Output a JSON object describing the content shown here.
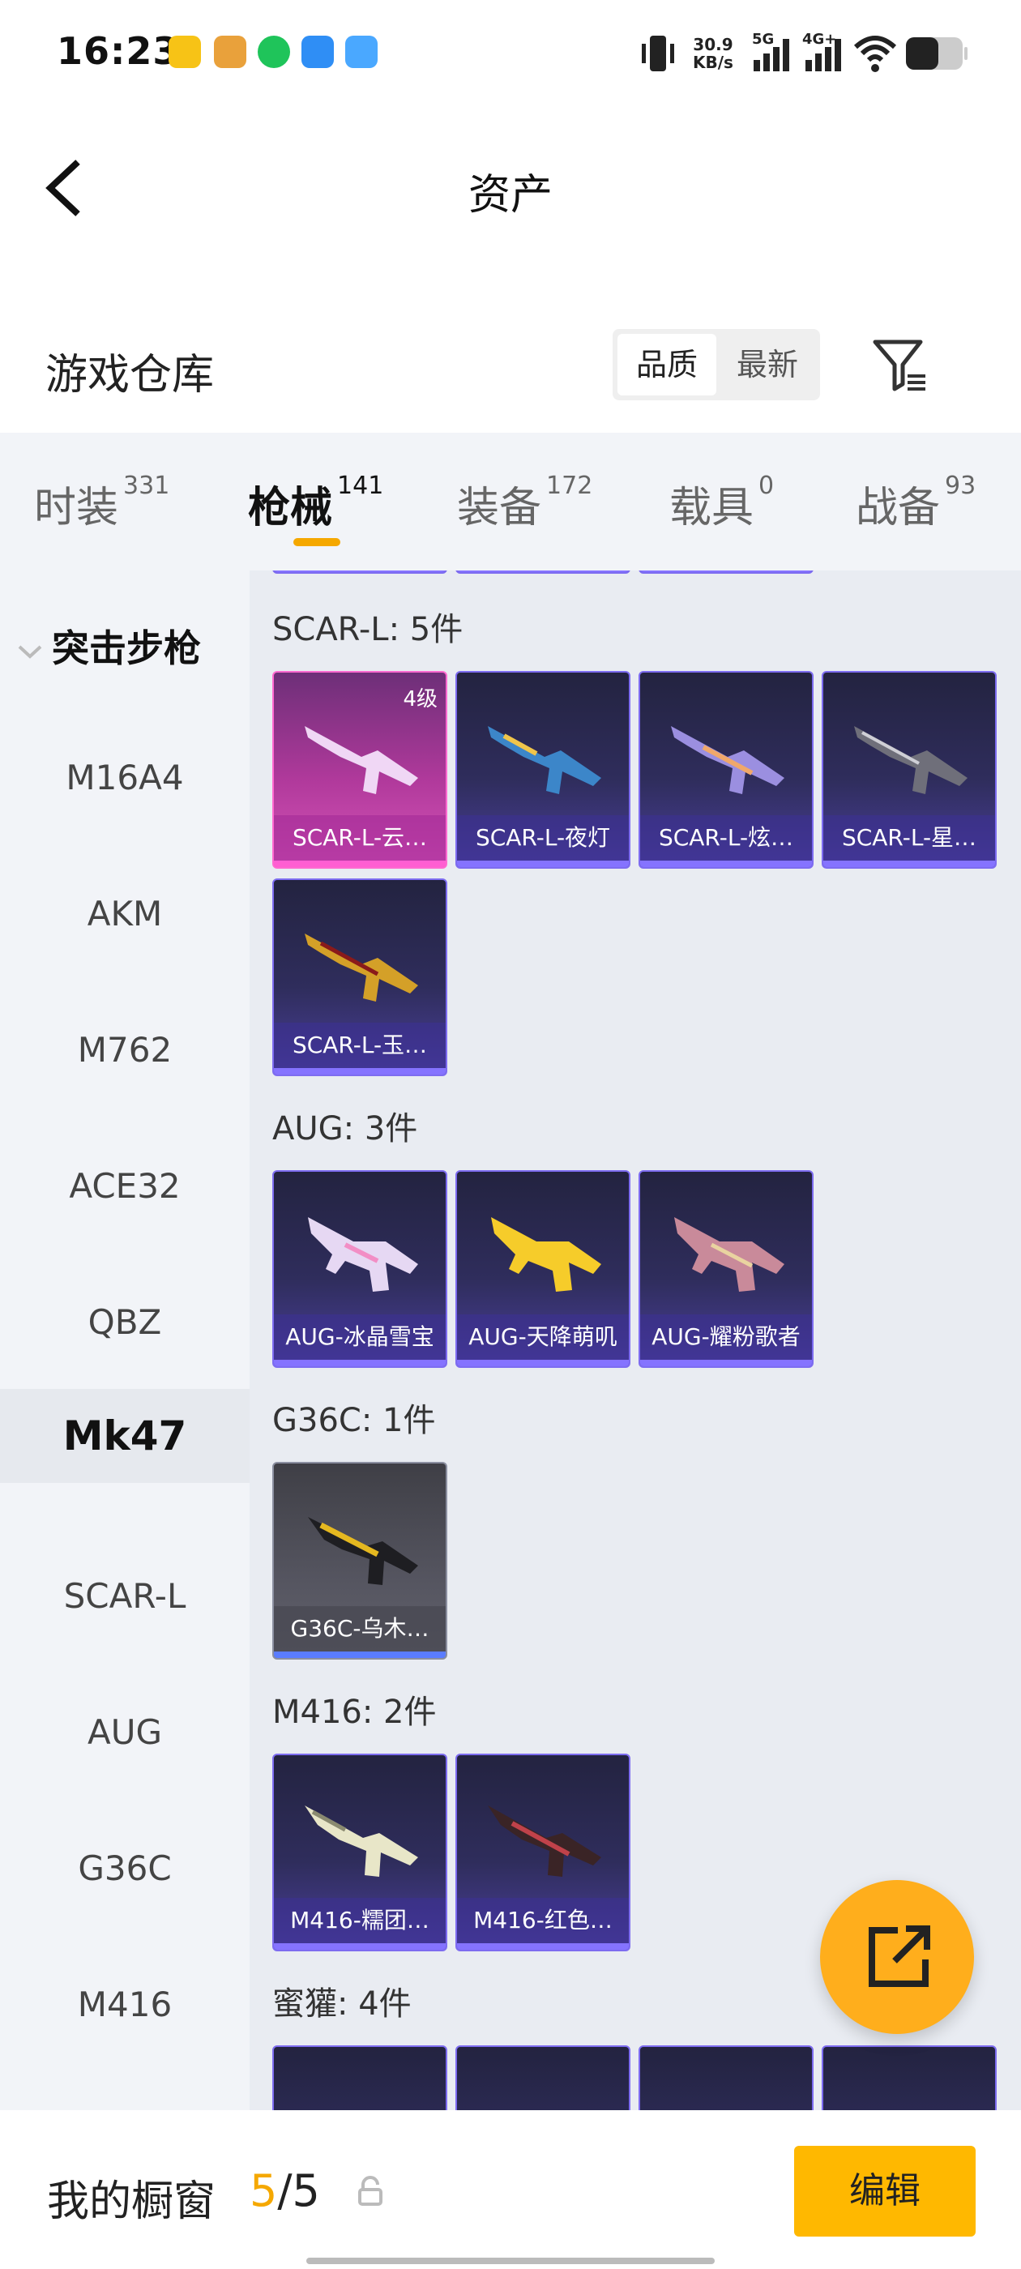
{
  "status_bar": {
    "time": "16:23",
    "net_speed_value": "30.9",
    "net_speed_unit": "KB/s",
    "signal1": "5G",
    "signal2": "4G+"
  },
  "header": {
    "title": "资产"
  },
  "warehouse": {
    "title": "游戏仓库",
    "sort_options": [
      "品质",
      "最新"
    ],
    "selected_sort": "品质"
  },
  "tabs": [
    {
      "label": "时装",
      "count": "331"
    },
    {
      "label": "枪械",
      "count": "141"
    },
    {
      "label": "装备",
      "count": "172"
    },
    {
      "label": "载具",
      "count": "0"
    },
    {
      "label": "战备",
      "count": "93"
    }
  ],
  "active_tab": "枪械",
  "sidebar": {
    "group": "突击步枪",
    "items": [
      "M16A4",
      "AKM",
      "M762",
      "ACE32",
      "QBZ",
      "Mk47",
      "SCAR-L",
      "AUG",
      "G36C",
      "M416"
    ],
    "active": "Mk47"
  },
  "groups": [
    {
      "title": "SCAR-L: 5件",
      "items": [
        {
          "name": "SCAR-L-云…",
          "level": "4级",
          "style": "pink"
        },
        {
          "name": "SCAR-L-夜灯",
          "style": "purple"
        },
        {
          "name": "SCAR-L-炫…",
          "style": "purple"
        },
        {
          "name": "SCAR-L-星…",
          "style": "purple"
        },
        {
          "name": "SCAR-L-玉…",
          "style": "purple"
        }
      ]
    },
    {
      "title": "AUG: 3件",
      "items": [
        {
          "name": "AUG-冰晶雪宝",
          "style": "purple"
        },
        {
          "name": "AUG-天降萌叽",
          "style": "purple"
        },
        {
          "name": "AUG-耀粉歌者",
          "style": "purple"
        }
      ]
    },
    {
      "title": "G36C: 1件",
      "items": [
        {
          "name": "G36C-乌木…",
          "style": "grey"
        }
      ]
    },
    {
      "title": "M416: 2件",
      "items": [
        {
          "name": "M416-糯团…",
          "style": "purple"
        },
        {
          "name": "M416-红色…",
          "style": "purple"
        }
      ]
    },
    {
      "title": "蜜獾: 4件",
      "items": []
    }
  ],
  "bottom_bar": {
    "label": "我的橱窗",
    "current": "5",
    "separator_total": "/5",
    "edit_label": "编辑"
  },
  "colors": {
    "accent": "#ffb800",
    "card_purple": "#2f2d5c",
    "card_pink": "#b0399b",
    "card_grey": "#555560"
  }
}
